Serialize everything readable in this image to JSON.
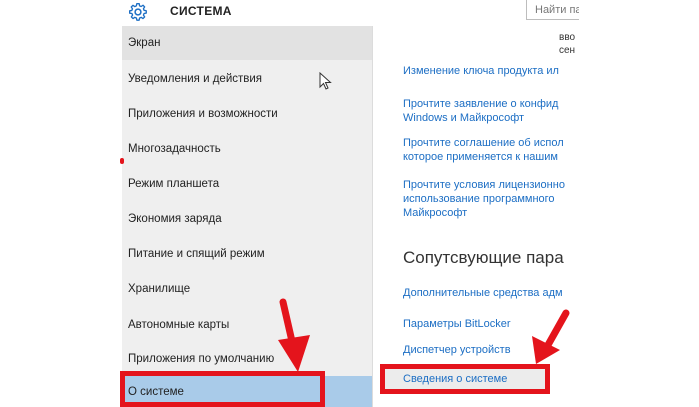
{
  "header": {
    "title": "СИСТЕМА",
    "search_placeholder": "Найти пар"
  },
  "sidebar": {
    "items": [
      {
        "label": "Экран"
      },
      {
        "label": "Уведомления и действия"
      },
      {
        "label": "Приложения и возможности"
      },
      {
        "label": "Многозадачность"
      },
      {
        "label": "Режим планшета"
      },
      {
        "label": "Экономия заряда"
      },
      {
        "label": "Питание и спящий режим"
      },
      {
        "label": "Хранилище"
      },
      {
        "label": "Автономные карты"
      },
      {
        "label": "Приложения по умолчанию"
      },
      {
        "label": "О системе"
      }
    ],
    "selected": "О системе"
  },
  "content": {
    "top_cut_text": [
      "вво",
      "сен"
    ],
    "links": [
      {
        "lines": [
          "Изменение ключа продукта ил"
        ]
      },
      {
        "lines": [
          "Прочтите заявление о конфид",
          "Windows и Майкрософт"
        ]
      },
      {
        "lines": [
          "Прочтите соглашение об испол",
          "которое применяется к нашим"
        ]
      },
      {
        "lines": [
          "Прочтите условия лицензионно",
          "использование программного",
          "Майкрософт"
        ]
      }
    ],
    "related_heading": "Сопутсвующие пара",
    "related_links": [
      {
        "label": "Дополнительные средства адм"
      },
      {
        "label": "Параметры BitLocker"
      },
      {
        "label": "Диспетчер устройств"
      },
      {
        "label": "Сведения о системе"
      }
    ]
  },
  "colors": {
    "accent_link": "#1c6ec4",
    "selected_bg": "#a9cbe9",
    "annotation_red": "#e4141c"
  },
  "icons": [
    "gear-icon",
    "mouse-cursor-icon",
    "red-arrow-annotation"
  ]
}
